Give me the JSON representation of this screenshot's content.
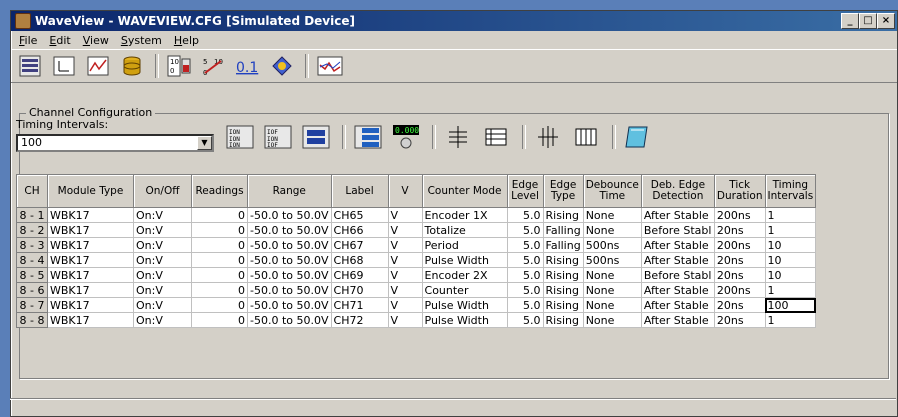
{
  "window": {
    "title": "WaveView - WAVEVIEW.CFG [Simulated Device]"
  },
  "menu": [
    "File",
    "Edit",
    "View",
    "System",
    "Help"
  ],
  "groupbox_title": "Channel Configuration",
  "timing_intervals": {
    "label": "Timing Intervals:",
    "value": "100"
  },
  "table": {
    "headers": [
      "CH",
      "Module Type",
      "On/Off",
      "Readings",
      "Range",
      "Label",
      "V",
      "Counter Mode",
      "Edge Level",
      "Edge Type",
      "Debounce Time",
      "Deb. Edge Detection",
      "Tick Duration",
      "Timing Intervals"
    ],
    "rows": [
      [
        "8 - 1",
        "WBK17",
        "On:V",
        "0",
        "-50.0 to 50.0V",
        "CH65",
        "V",
        "Encoder 1X",
        "5.0",
        "Rising",
        "None",
        "After Stable",
        "200ns",
        "1"
      ],
      [
        "8 - 2",
        "WBK17",
        "On:V",
        "0",
        "-50.0 to 50.0V",
        "CH66",
        "V",
        "Totalize",
        "5.0",
        "Falling",
        "None",
        "Before Stabl",
        "20ns",
        "1"
      ],
      [
        "8 - 3",
        "WBK17",
        "On:V",
        "0",
        "-50.0 to 50.0V",
        "CH67",
        "V",
        "Period",
        "5.0",
        "Falling",
        "500ns",
        "After Stable",
        "200ns",
        "10"
      ],
      [
        "8 - 4",
        "WBK17",
        "On:V",
        "0",
        "-50.0 to 50.0V",
        "CH68",
        "V",
        "Pulse Width",
        "5.0",
        "Rising",
        "500ns",
        "After Stable",
        "20ns",
        "10"
      ],
      [
        "8 - 5",
        "WBK17",
        "On:V",
        "0",
        "-50.0 to 50.0V",
        "CH69",
        "V",
        "Encoder 2X",
        "5.0",
        "Rising",
        "None",
        "Before Stabl",
        "20ns",
        "10"
      ],
      [
        "8 - 6",
        "WBK17",
        "On:V",
        "0",
        "-50.0 to 50.0V",
        "CH70",
        "V",
        "Counter",
        "5.0",
        "Rising",
        "None",
        "After Stable",
        "200ns",
        "1"
      ],
      [
        "8 - 7",
        "WBK17",
        "On:V",
        "0",
        "-50.0 to 50.0V",
        "CH71",
        "V",
        "Pulse Width",
        "5.0",
        "Rising",
        "None",
        "After Stable",
        "20ns",
        "100"
      ],
      [
        "8 - 8",
        "WBK17",
        "On:V",
        "0",
        "-50.0 to 50.0V",
        "CH72",
        "V",
        "Pulse Width",
        "5.0",
        "Rising",
        "None",
        "After Stable",
        "20ns",
        "1"
      ]
    ]
  },
  "toolbar_icons": [
    "channel-config-icon",
    "data-display-icon",
    "chart-window-icon",
    "database-icon",
    "digital-meter-icon",
    "analog-meter-icon",
    "digital-value-icon",
    "diamond-icon",
    "scope-icon"
  ],
  "channel_tool_icons": [
    "channels-on-icon",
    "channels-off-icon",
    "channel-toggle-icon",
    "ranges-icon",
    "readout-icon",
    "collapse-rows-icon",
    "list-icon",
    "expand-cols-icon",
    "columns-icon",
    "notebook-icon"
  ]
}
